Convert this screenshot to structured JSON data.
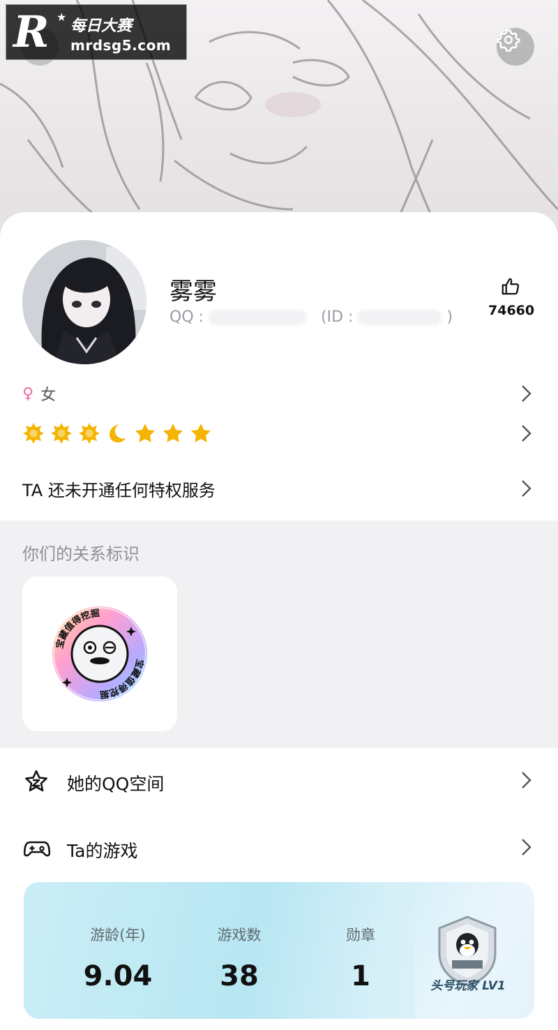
{
  "watermark": {
    "logo": "R",
    "title": "每日大赛",
    "domain": "mrdsg5.com"
  },
  "profile": {
    "nickname": "雾雾",
    "qq_prefix": "QQ :",
    "id_prefix": "(ID :",
    "id_suffix": ")",
    "likes": "74660",
    "gender_symbol": "♀",
    "gender": "女",
    "privilege_text": "TA 还未开通任何特权服务"
  },
  "level_icons": [
    "sun-icon",
    "sun-icon",
    "sun-icon",
    "moon-icon",
    "star-icon",
    "star-icon",
    "star-icon"
  ],
  "relation": {
    "title": "你们的关系标识",
    "badge_ring_text": "宝藏值得挖掘"
  },
  "list": {
    "qzone": "她的QQ空间",
    "games": "Ta的游戏"
  },
  "game_stats": {
    "items": [
      {
        "label": "游龄(年)",
        "value": "9.04"
      },
      {
        "label": "游戏数",
        "value": "38"
      },
      {
        "label": "勋章",
        "value": "1"
      }
    ],
    "medal_title": "头号玩家 LV1"
  },
  "colors": {
    "gender_pink": "#f06aa4",
    "sun_gold": "#f5b400",
    "section_bg": "#f1f1f4",
    "secondary_text": "#9a9ca3"
  }
}
